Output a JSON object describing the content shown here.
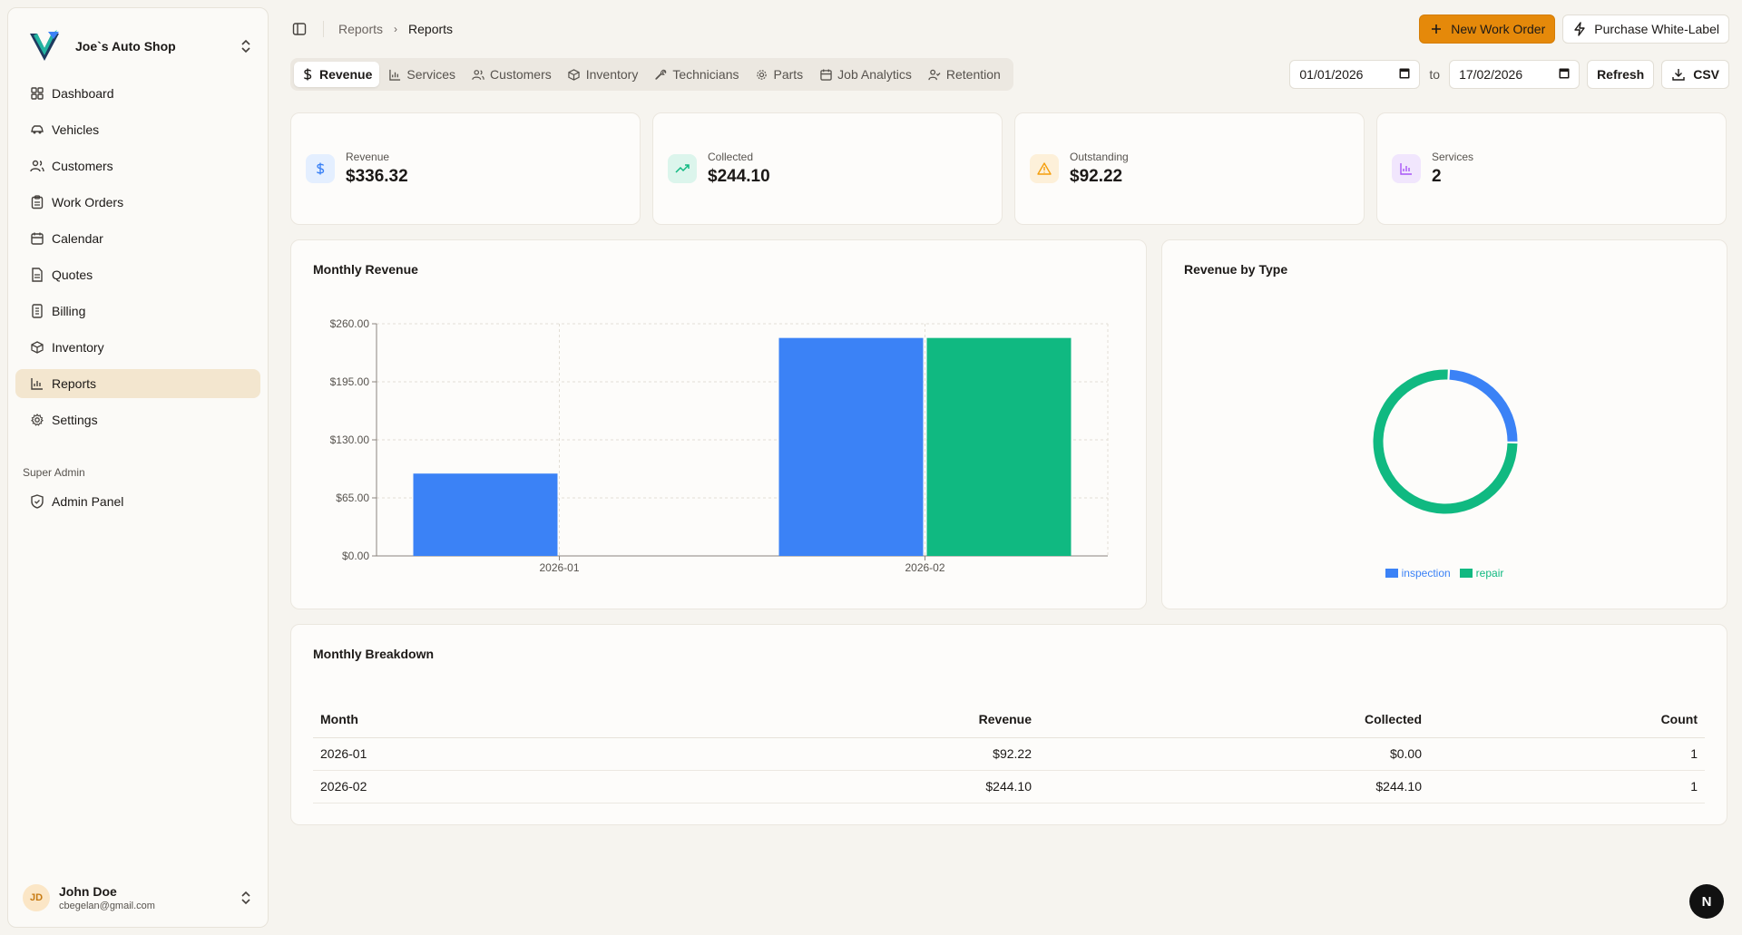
{
  "app": {
    "shop_name": "Joe`s Auto Shop"
  },
  "sidebar": {
    "items": [
      {
        "label": "Dashboard",
        "icon": "layout-grid-icon"
      },
      {
        "label": "Vehicles",
        "icon": "car-icon"
      },
      {
        "label": "Customers",
        "icon": "users-icon"
      },
      {
        "label": "Work Orders",
        "icon": "clipboard-icon"
      },
      {
        "label": "Calendar",
        "icon": "calendar-icon"
      },
      {
        "label": "Quotes",
        "icon": "file-icon"
      },
      {
        "label": "Billing",
        "icon": "receipt-icon"
      },
      {
        "label": "Inventory",
        "icon": "package-icon"
      },
      {
        "label": "Reports",
        "icon": "bar-chart-icon",
        "active": true
      },
      {
        "label": "Settings",
        "icon": "gear-icon"
      }
    ],
    "section_label": "Super Admin",
    "admin_item": {
      "label": "Admin Panel",
      "icon": "shield-icon"
    },
    "user": {
      "initials": "JD",
      "name": "John Doe",
      "email": "cbegelan@gmail.com"
    }
  },
  "header": {
    "breadcrumb": [
      "Reports",
      "Reports"
    ],
    "new_work_order": "New Work Order",
    "purchase": "Purchase White-Label"
  },
  "tabs": [
    {
      "label": "Revenue",
      "active": true
    },
    {
      "label": "Services"
    },
    {
      "label": "Customers"
    },
    {
      "label": "Inventory"
    },
    {
      "label": "Technicians"
    },
    {
      "label": "Parts"
    },
    {
      "label": "Job Analytics"
    },
    {
      "label": "Retention"
    }
  ],
  "filters": {
    "from": "01/01/2026",
    "to_label": "to",
    "to": "17/02/2026",
    "refresh": "Refresh",
    "csv": "CSV"
  },
  "stats": [
    {
      "label": "Revenue",
      "value": "$336.32",
      "color": "#3b82f6"
    },
    {
      "label": "Collected",
      "value": "$244.10",
      "color": "#10b981"
    },
    {
      "label": "Outstanding",
      "value": "$92.22",
      "color": "#f59e0b"
    },
    {
      "label": "Services",
      "value": "2",
      "color": "#a855f7"
    }
  ],
  "monthly_chart_title": "Monthly Revenue",
  "type_chart_title": "Revenue by Type",
  "breakdown": {
    "title": "Monthly Breakdown",
    "columns": [
      "Month",
      "Revenue",
      "Collected",
      "Count"
    ],
    "rows": [
      [
        "2026-01",
        "$92.22",
        "$0.00",
        "1"
      ],
      [
        "2026-02",
        "$244.10",
        "$244.10",
        "1"
      ]
    ]
  },
  "chart_data": [
    {
      "type": "bar",
      "title": "Monthly Revenue",
      "categories": [
        "2026-01",
        "2026-02"
      ],
      "series": [
        {
          "values": [
            92.22,
            244.1
          ],
          "color": "#3b82f6"
        },
        {
          "values": [
            0,
            244.1
          ],
          "color": "#10b981"
        }
      ],
      "ylim": [
        0,
        260
      ],
      "yticks": [
        "$0.00",
        "$65.00",
        "$130.00",
        "$195.00",
        "$260.00"
      ],
      "ytick_values": [
        0,
        65,
        130,
        195,
        260
      ],
      "grid": true
    },
    {
      "type": "pie",
      "title": "Revenue by Type",
      "labels": [
        "inspection",
        "repair"
      ],
      "values": [
        82,
        254.32
      ],
      "colors": [
        "#3b82f6",
        "#10b981"
      ],
      "legend": "bottom"
    }
  ],
  "floating": {
    "label": "N"
  }
}
